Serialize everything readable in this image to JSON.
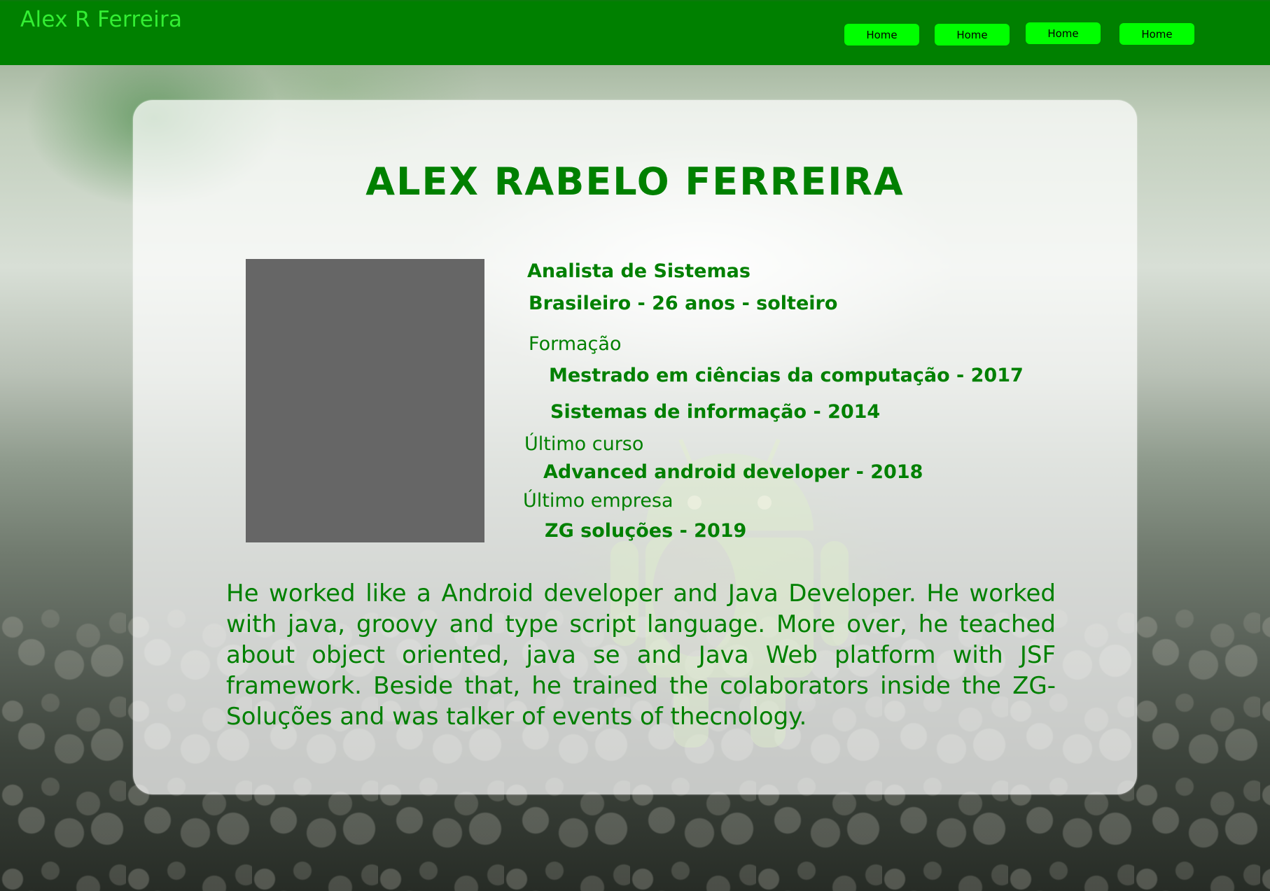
{
  "header": {
    "brand": "Alex R Ferreira",
    "nav": [
      {
        "label": "Home"
      },
      {
        "label": "Home"
      },
      {
        "label": "Home"
      },
      {
        "label": "Home"
      }
    ]
  },
  "profile": {
    "name": "ALEX RABELO FERREIRA",
    "role": "Analista de Sistemas",
    "personal": "Brasileiro - 26 anos - solteiro",
    "education_heading": "Formação",
    "education": [
      "Mestrado em ciências da computação - 2017",
      "Sistemas de informação - 2014"
    ],
    "last_course_heading": "Último curso",
    "last_course": "Advanced android developer - 2018",
    "last_company_heading": "Último empresa",
    "last_company": "ZG soluções - 2019",
    "bio": "He worked like a Android developer and Java Developer. He worked with java, groovy and type script language. More over, he teached about object oriented, java se and Java Web platform with JSF framework. Beside that, he trained the colaborators inside the ZG-Soluções and was talker of events of thecnology."
  },
  "colors": {
    "navbar": "#008000",
    "brand_text": "#33ee33",
    "nav_button": "#00ff00",
    "text_green": "#008000",
    "photo_placeholder": "#666666"
  }
}
